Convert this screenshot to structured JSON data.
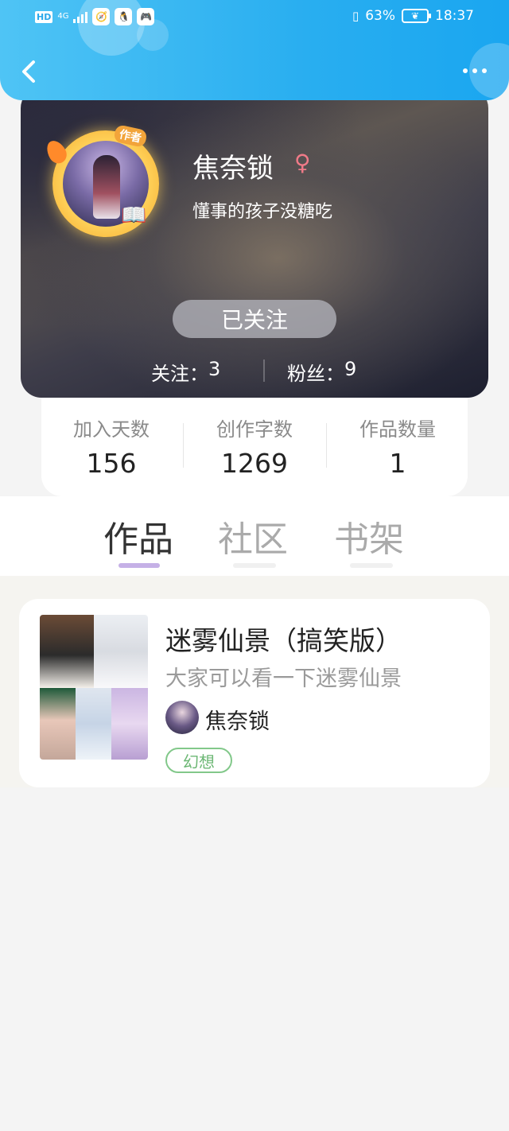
{
  "status_bar": {
    "hd": "HD",
    "network": "4G",
    "battery": "63%",
    "time": "18:37"
  },
  "header": {
    "back_icon": "chevron-left-icon",
    "more_icon": "more-dots-icon"
  },
  "profile": {
    "author_badge": "作者",
    "name": "焦奈锁",
    "gender_icon": "♀",
    "signature": "懂事的孩子没糖吃",
    "follow_button": "已关注",
    "following_label": "关注：",
    "following_count": "3",
    "fans_label": "粉丝：",
    "fans_count": "9"
  },
  "stats": [
    {
      "label": "加入天数",
      "value": "156"
    },
    {
      "label": "创作字数",
      "value": "1269"
    },
    {
      "label": "作品数量",
      "value": "1"
    }
  ],
  "tabs": [
    {
      "label": "作品",
      "active": true
    },
    {
      "label": "社区",
      "active": false
    },
    {
      "label": "书架",
      "active": false
    }
  ],
  "works": [
    {
      "title": "迷雾仙景（搞笑版）",
      "description": "大家可以看一下迷雾仙景",
      "author": "焦奈锁",
      "tag": "幻想"
    }
  ],
  "colors": {
    "header": "#29aef0",
    "tab_indicator": "#c5b0e6",
    "tag": "#82c88a"
  }
}
